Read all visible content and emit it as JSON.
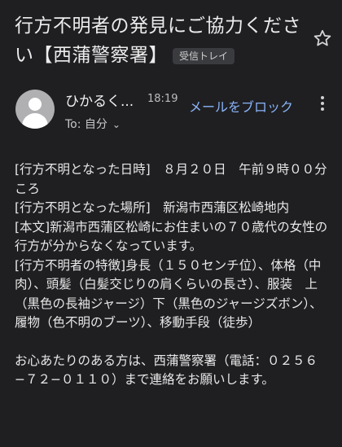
{
  "subject": "行方不明者の発見にご協力ください【西蒲警察署】",
  "label": "受信トレイ",
  "sender": {
    "name": "ひかるく...",
    "time": "18:19",
    "block_link": "メールをブロック",
    "to_label": "To: 自分",
    "to_chevron": "⌄"
  },
  "body": {
    "lines": [
      "[行方不明となった日時]　８月２０日　午前９時００分ころ",
      "[行方不明となった場所]　新潟市西蒲区松崎地内",
      "[本文]新潟市西蒲区松崎にお住まいの７０歳代の女性の行方が分からなくなっています。",
      "[行方不明者の特徴]身長（１５０センチ位）、体格（中肉）、頭髪（白髪交じりの肩くらいの長さ）、服装　上（黒色の長袖ジャージ）下（黒色のジャージズボン）、履物（色不明のブーツ）、移動手段（徒歩）",
      "お心あたりのある方は、西蒲警察署（電話：０２５６−７２−０１１０）まで連絡をお願いします。"
    ]
  },
  "icons": {
    "star": "star-outline-icon",
    "avatar": "person-avatar-icon",
    "more": "more-vert-icon"
  },
  "colors": {
    "background": "#1f1f22",
    "link": "#8ab4f8",
    "label_bg": "#3a3b3f"
  }
}
